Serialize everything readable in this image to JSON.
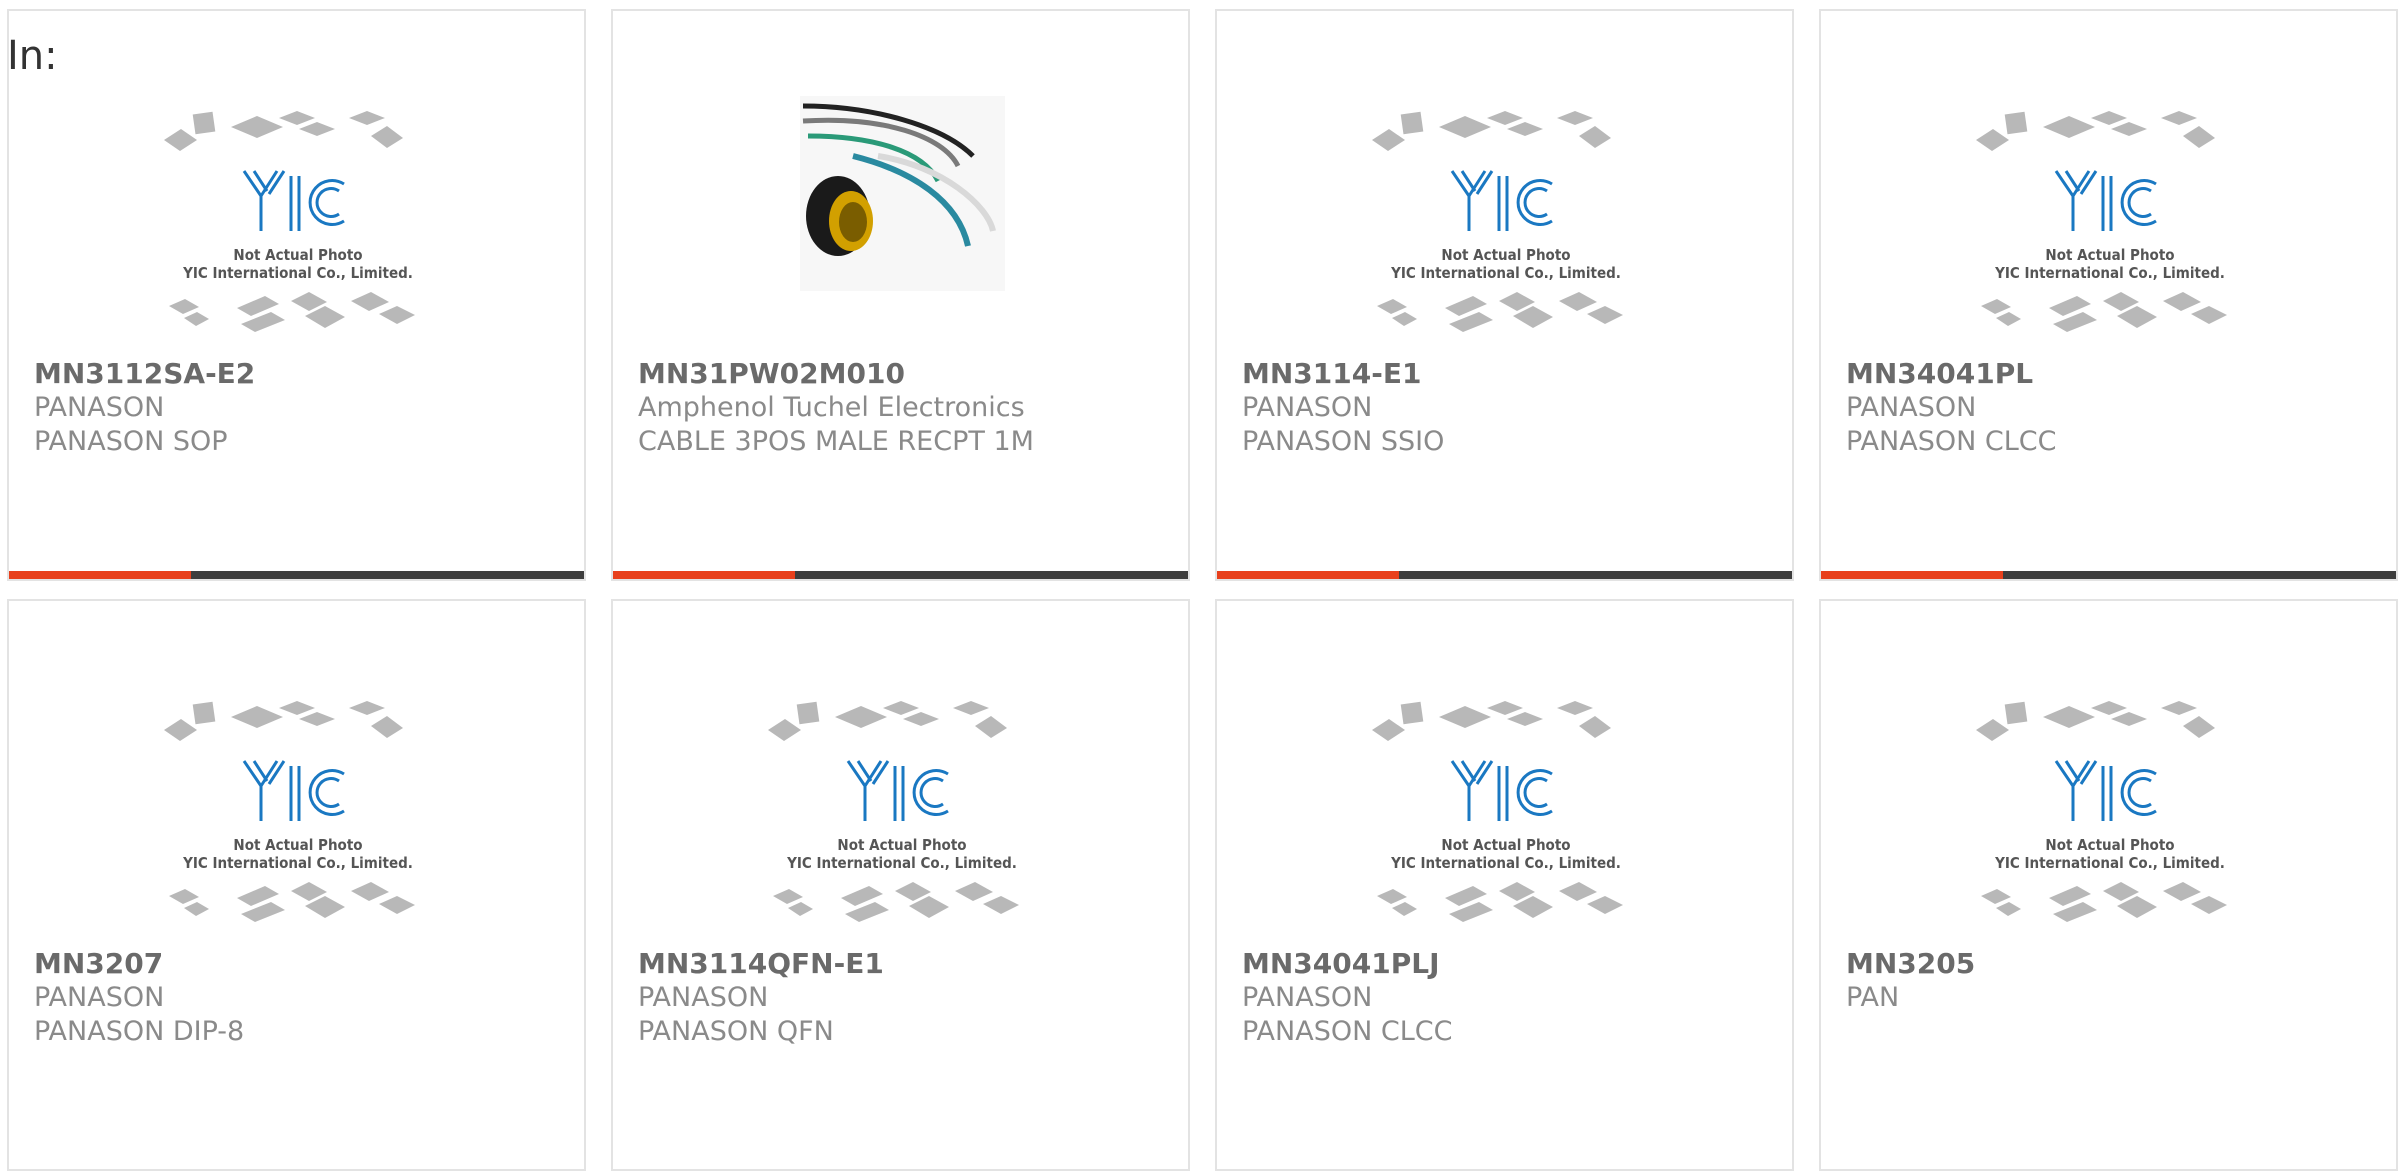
{
  "header": {
    "label": "In:"
  },
  "placeholder": {
    "line1": "Not Actual Photo",
    "line2": "YIC International Co., Limited.",
    "logo": "YIC"
  },
  "products": [
    {
      "part": "MN3112SA-E2",
      "maker": "PANASON",
      "desc": "PANASON SOP",
      "image": "placeholder"
    },
    {
      "part": "MN31PW02M010",
      "maker": "Amphenol Tuchel Electronics",
      "desc": "CABLE 3POS MALE RECPT 1M",
      "image": "cable"
    },
    {
      "part": "MN3114-E1",
      "maker": "PANASON",
      "desc": "PANASON SSIO",
      "image": "placeholder"
    },
    {
      "part": "MN34041PL",
      "maker": "PANASON",
      "desc": "PANASON CLCC",
      "image": "placeholder"
    },
    {
      "part": "MN3207",
      "maker": "PANASON",
      "desc": "PANASON DIP-8",
      "image": "placeholder"
    },
    {
      "part": "MN3114QFN-E1",
      "maker": "PANASON",
      "desc": "PANASON QFN",
      "image": "placeholder"
    },
    {
      "part": "MN34041PLJ",
      "maker": "PANASON",
      "desc": "PANASON CLCC",
      "image": "placeholder"
    },
    {
      "part": "MN3205",
      "maker": "PAN",
      "desc": "",
      "image": "placeholder"
    }
  ],
  "colors": {
    "accent": "#e8401c",
    "bar": "#3d3d3d",
    "logo": "#1a78c2",
    "chip": "#b8b8b8"
  }
}
